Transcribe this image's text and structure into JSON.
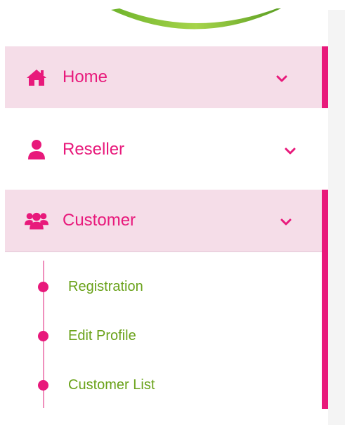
{
  "sidebar": {
    "items": [
      {
        "label": "Home",
        "icon": "home-icon",
        "active": true
      },
      {
        "label": "Reseller",
        "icon": "user-icon",
        "active": false
      },
      {
        "label": "Customer",
        "icon": "users-group-icon",
        "active": true,
        "expanded": true
      }
    ],
    "customer_submenu": [
      {
        "label": "Registration"
      },
      {
        "label": "Edit Profile"
      },
      {
        "label": "Customer List"
      }
    ]
  },
  "colors": {
    "accent": "#e8197b",
    "active_bg": "#f5dde8",
    "submenu_text": "#6aa21a",
    "tree_line": "#ef8fbc",
    "logo_green": "#8cc63f"
  }
}
